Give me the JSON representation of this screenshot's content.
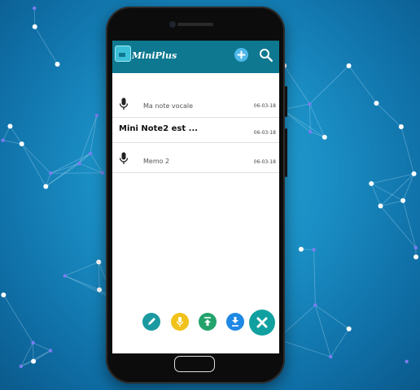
{
  "app": {
    "title": "MiniPlus"
  },
  "toolbar": {
    "add_icon": "plus-circle-icon",
    "search_icon": "search-icon"
  },
  "notes": [
    {
      "type": "voice",
      "icon": "microphone-icon",
      "label": "Ma note vocale",
      "date": "06-03-18"
    },
    {
      "type": "text",
      "title": "Mini Note2 est ...",
      "date": "06-03-18"
    },
    {
      "type": "voice",
      "icon": "microphone-icon",
      "label": "Memo 2",
      "date": "06-03-18"
    }
  ],
  "fab_menu": [
    {
      "name": "edit",
      "icon": "pencil-icon",
      "color": "#1a9aa0"
    },
    {
      "name": "voice",
      "icon": "microphone-icon",
      "color": "#f0c21a"
    },
    {
      "name": "upload",
      "icon": "upload-icon",
      "color": "#23a36c"
    },
    {
      "name": "download",
      "icon": "download-icon",
      "color": "#1e88e5"
    },
    {
      "name": "close",
      "icon": "close-icon",
      "color": "#11a0a0"
    }
  ],
  "colors": {
    "appbar": "#0e7890",
    "background": "#1a8ec4"
  }
}
